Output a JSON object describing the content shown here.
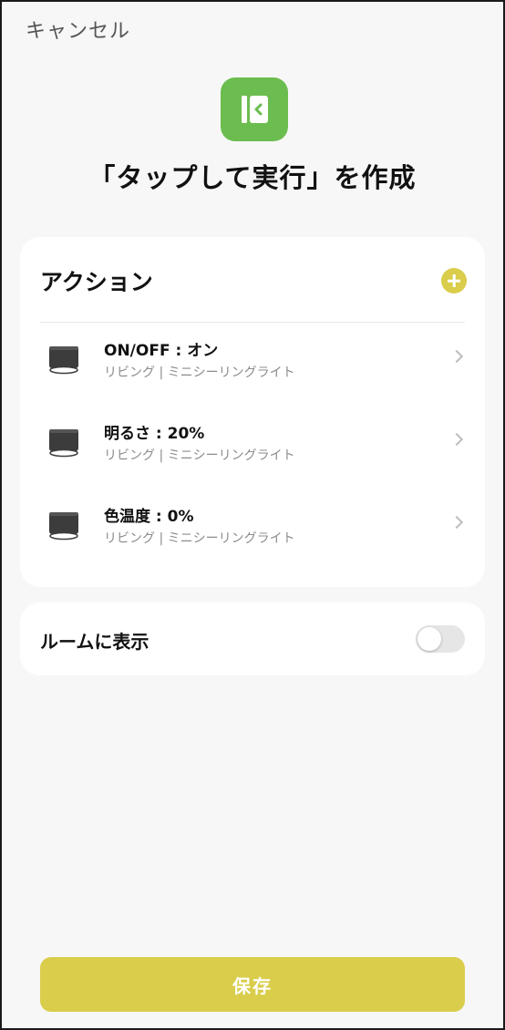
{
  "header": {
    "cancel_label": "キャンセル",
    "title": "「タップして実行」を作成",
    "app_icon": "tap-to-run-icon"
  },
  "actions": {
    "header_label": "アクション",
    "add_icon": "plus-icon",
    "items": [
      {
        "title": "ON/OFF : オン",
        "subtitle": "リビング | ミニシーリングライト",
        "icon": "ceiling-light-icon"
      },
      {
        "title": "明るさ : 20%",
        "subtitle": "リビング | ミニシーリングライト",
        "icon": "ceiling-light-icon"
      },
      {
        "title": "色温度 : 0%",
        "subtitle": "リビング | ミニシーリングライト",
        "icon": "ceiling-light-icon"
      }
    ]
  },
  "room": {
    "label": "ルームに表示",
    "toggle_on": false
  },
  "footer": {
    "save_label": "保存"
  },
  "colors": {
    "accent": "#d9cd4b",
    "app_icon_bg": "#6cbd4f",
    "background": "#f7f7f7"
  }
}
